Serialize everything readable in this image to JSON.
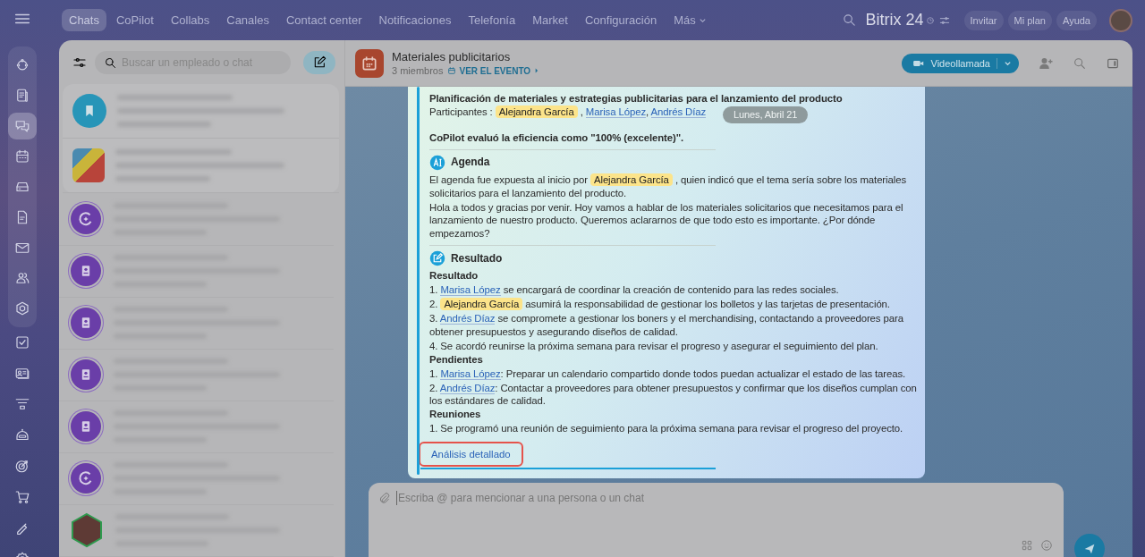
{
  "top_nav": {
    "tabs": [
      {
        "label": "Chats",
        "selected": true
      },
      {
        "label": "CoPilot",
        "selected": false
      },
      {
        "label": "Collabs",
        "selected": false
      },
      {
        "label": "Canales",
        "selected": false
      },
      {
        "label": "Contact center",
        "selected": false
      },
      {
        "label": "Notificaciones",
        "selected": false
      },
      {
        "label": "Telefonía",
        "selected": false
      },
      {
        "label": "Market",
        "selected": false
      },
      {
        "label": "Configuración",
        "selected": false
      }
    ],
    "more": "Más",
    "brand": "Bitrix 24",
    "buttons": [
      "Invitar",
      "Mi plan",
      "Ayuda"
    ]
  },
  "rail": [
    {
      "kind": "activity",
      "selected": false
    },
    {
      "kind": "feed",
      "selected": false
    },
    {
      "kind": "chat",
      "selected": true
    },
    {
      "kind": "calendar",
      "selected": false
    },
    {
      "kind": "drive",
      "selected": false
    },
    {
      "kind": "document",
      "selected": false
    },
    {
      "kind": "mail",
      "selected": false
    },
    {
      "kind": "people",
      "selected": false
    },
    {
      "kind": "hexagon",
      "selected": false
    },
    {
      "kind": "tasks",
      "selected": false
    },
    {
      "kind": "card",
      "selected": false
    },
    {
      "kind": "funnel",
      "selected": false
    },
    {
      "kind": "robot",
      "selected": false
    },
    {
      "kind": "target",
      "selected": false
    },
    {
      "kind": "cart",
      "selected": false
    },
    {
      "kind": "pen",
      "selected": false
    },
    {
      "kind": "gear",
      "selected": false
    }
  ],
  "chat_list": {
    "search_placeholder": "Buscar un empleado o chat",
    "chats": [
      {
        "kind": "bookmark",
        "pinned": true
      },
      {
        "kind": "photo",
        "pinned": true
      },
      {
        "kind": "copilot",
        "pinned": false
      },
      {
        "kind": "contact",
        "pinned": false
      },
      {
        "kind": "contact",
        "pinned": false
      },
      {
        "kind": "contact",
        "pinned": false
      },
      {
        "kind": "contact",
        "pinned": false
      },
      {
        "kind": "copilot",
        "pinned": false
      },
      {
        "kind": "hex-photo",
        "pinned": false
      }
    ]
  },
  "chat": {
    "title": "Materiales publicitarios",
    "members": "3 miembros",
    "event_link": "VER EL EVENTO",
    "call_button": "Videollamada",
    "date_badge": "Lunes, Abril 21",
    "message": {
      "title": "Planificación de materiales y estrategias publicitarias para el lanzamiento del producto",
      "participants": [
        {
          "kind": "plain",
          "text": "Participantes : "
        },
        {
          "kind": "highlight",
          "text": "Alejandra García"
        },
        {
          "kind": "plain",
          "text": " , "
        },
        {
          "kind": "mention",
          "text": "Marisa López"
        },
        {
          "kind": "plain",
          "text": ", "
        },
        {
          "kind": "mention",
          "text": "Andrés Díaz"
        }
      ],
      "evaluation": "CoPilot evaluó la eficiencia como \"100% (excelente)\".",
      "sections": [
        {
          "kind": "agenda",
          "title": "Agenda",
          "lines": [
            {
              "kind": "text",
              "parts": [
                {
                  "kind": "plain",
                  "text": "El agenda fue expuesta al inicio por "
                },
                {
                  "kind": "highlight",
                  "text": "Alejandra García"
                },
                {
                  "kind": "plain",
                  "text": " , quien indicó que el tema sería sobre los materiales solicitarios para el lanzamiento del producto."
                }
              ]
            },
            {
              "kind": "text",
              "parts": [
                {
                  "kind": "plain",
                  "text": "Hola a todos y gracias por venir. Hoy vamos a hablar de los materiales solicitarios que necesitamos para el lanzamiento de nuestro producto. Queremos aclararnos de que todo esto es importante. ¿Por dónde empezamos?"
                }
              ]
            }
          ]
        },
        {
          "kind": "result",
          "title": "Resultado",
          "lines": [
            {
              "kind": "heading",
              "text": "Resultado"
            },
            {
              "kind": "text",
              "parts": [
                {
                  "kind": "plain",
                  "text": "1. "
                },
                {
                  "kind": "mention",
                  "text": "Marisa López"
                },
                {
                  "kind": "plain",
                  "text": " se encargará de coordinar la creación de contenido para las redes sociales."
                }
              ]
            },
            {
              "kind": "text",
              "parts": [
                {
                  "kind": "plain",
                  "text": "2. "
                },
                {
                  "kind": "highlight",
                  "text": "Alejandra García"
                },
                {
                  "kind": "plain",
                  "text": " asumirá la responsabilidad de gestionar los bolletos y las tarjetas de presentación."
                }
              ]
            },
            {
              "kind": "text",
              "parts": [
                {
                  "kind": "plain",
                  "text": "3. "
                },
                {
                  "kind": "mention",
                  "text": "Andrés Díaz"
                },
                {
                  "kind": "plain",
                  "text": " se compromete a gestionar los boners y el merchandising, contactando a proveedores para obtener presupuestos y asegurando diseños de calidad."
                }
              ]
            },
            {
              "kind": "text",
              "parts": [
                {
                  "kind": "plain",
                  "text": "4. Se acordó reunirse la próxima semana para revisar el progreso y asegurar el seguimiento del plan."
                }
              ]
            },
            {
              "kind": "heading",
              "text": "Pendientes"
            },
            {
              "kind": "text",
              "parts": [
                {
                  "kind": "plain",
                  "text": "1. "
                },
                {
                  "kind": "mention",
                  "text": "Marisa López"
                },
                {
                  "kind": "plain",
                  "text": ": Preparar un calendario compartido donde todos puedan actualizar el estado de las tareas."
                }
              ]
            },
            {
              "kind": "text",
              "parts": [
                {
                  "kind": "plain",
                  "text": "2. "
                },
                {
                  "kind": "mention",
                  "text": "Andrés Díaz"
                },
                {
                  "kind": "plain",
                  "text": ": Contactar a proveedores para obtener presupuestos y confirmar que los diseños cumplan con los estándares de calidad."
                }
              ]
            },
            {
              "kind": "heading",
              "text": "Reuniones"
            },
            {
              "kind": "text",
              "parts": [
                {
                  "kind": "plain",
                  "text": "1. Se programó una reunión de seguimiento para la próxima semana para revisar el progreso del proyecto."
                }
              ]
            }
          ]
        }
      ],
      "detail_link": {
        "label": "Análisis detallado",
        "highlighted": true
      }
    },
    "composer": {
      "placeholder": "Escriba @ para mencionar a una persona o un chat"
    }
  }
}
